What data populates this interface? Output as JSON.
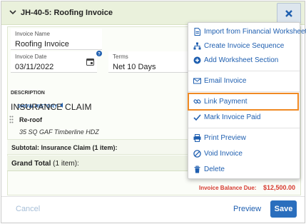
{
  "header": {
    "title": "JH-40-5: Roofing Invoice"
  },
  "form": {
    "invoice_name": {
      "label": "Invoice Name",
      "value": "Roofing Invoice"
    },
    "invoice_date": {
      "label": "Invoice Date",
      "value": "03/11/2022"
    },
    "terms": {
      "label": "Terms",
      "value": "Net 10 Days"
    }
  },
  "content": {
    "show_history": "SHOW HISTORY",
    "description_header": "DESCRIPTION",
    "section_title": "INSURANCE CLAIM",
    "item_name": "Re-roof",
    "item_desc": "35 SQ GAF Timberline HDZ",
    "subtotal": "Subtotal: Insurance Claim (1 item):",
    "grand_total_label": "Grand Total",
    "grand_total_count": "(1 item):",
    "balance_label": "Invoice Balance Due:",
    "balance_value": "$12,500.00"
  },
  "footer": {
    "cancel": "Cancel",
    "preview": "Preview",
    "save": "Save"
  },
  "menu": {
    "items": [
      {
        "label": "Import from Financial Worksheet",
        "icon": "document-icon"
      },
      {
        "label": "Create Invoice Sequence",
        "icon": "hierarchy-icon"
      },
      {
        "label": "Add Worksheet Section",
        "icon": "plus-circle-icon"
      },
      {
        "label": "Email Invoice",
        "icon": "envelope-icon"
      },
      {
        "label": "Link Payment",
        "icon": "link-icon"
      },
      {
        "label": "Mark Invoice Paid",
        "icon": "checkmark-icon"
      },
      {
        "label": "Print Preview",
        "icon": "printer-icon"
      },
      {
        "label": "Void Invoice",
        "icon": "void-icon"
      },
      {
        "label": "Delete",
        "icon": "trash-icon"
      }
    ]
  },
  "colors": {
    "accent": "#1f5fb0",
    "highlight": "#f08a24",
    "balance": "#d63a2f",
    "save": "#2a6ebd"
  }
}
